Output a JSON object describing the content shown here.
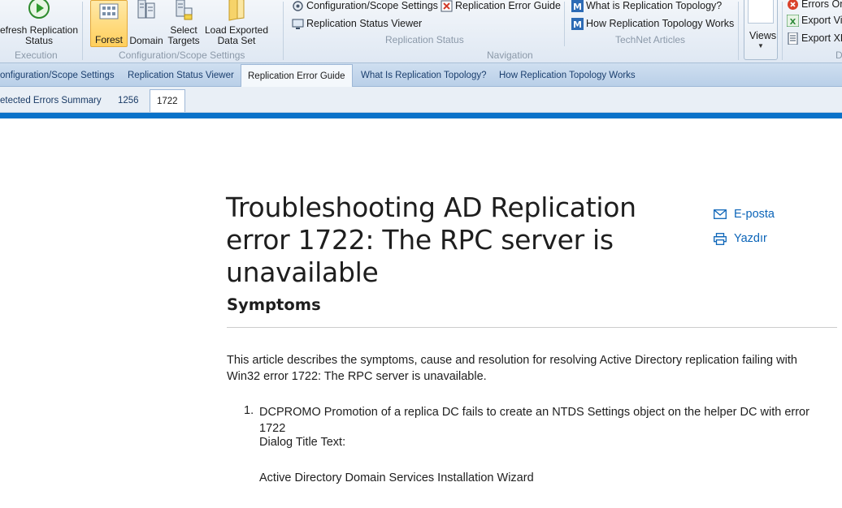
{
  "ribbon": {
    "execution": {
      "label": "Execution",
      "refresh": "efresh Replication\nStatus"
    },
    "config": {
      "label": "Configuration/Scope Settings",
      "forest": "Forest",
      "domain": "Domain",
      "select_targets": "Select\nTargets",
      "load_exported": "Load Exported\nData Set"
    },
    "replication_status": {
      "label": "Replication Status",
      "config_scope": "Configuration/Scope Settings",
      "error_guide": "Replication Error Guide",
      "status_viewer": "Replication Status Viewer"
    },
    "navigation": {
      "label": "Navigation"
    },
    "technet": {
      "label": "TechNet Articles",
      "what_is": "What is Replication Topology?",
      "how": "How Replication Topology Works"
    },
    "views": {
      "label": "Views"
    },
    "export": {
      "label": "D",
      "errors_only": "Errors On",
      "export_view": "Export Vie",
      "export_xps": "Export XP"
    }
  },
  "tabs_primary": [
    {
      "label": "onfiguration/Scope Settings"
    },
    {
      "label": "Replication Status Viewer"
    },
    {
      "label": "Replication Error Guide"
    },
    {
      "label": "What Is Replication Topology?"
    },
    {
      "label": "How Replication Topology Works"
    }
  ],
  "tabs_secondary": [
    {
      "label": "etected Errors Summary"
    },
    {
      "label": "1256"
    },
    {
      "label": "1722"
    }
  ],
  "article": {
    "title": "Troubleshooting AD Replication error 1722: The RPC server is unavailable",
    "email": "E-posta",
    "print": "Yazdır",
    "section": "Symptoms",
    "intro": " This article describes the symptoms, cause and resolution for resolving Active Directory replication failing with Win32 error 1722: The RPC server is unavailable.",
    "item1_number": "1.",
    "item1_text": "DCPROMO Promotion of a replica DC fails to create an NTDS Settings object on the helper DC with error 1722",
    "dialog_title": "Dialog Title Text:",
    "wizard": "Active Directory Domain Services Installation Wizard"
  },
  "colors": {
    "accent_blue": "#0a72c9",
    "link": "#0b64b8",
    "tab_text": "#1b3f6e",
    "active_button": "#ffcf5c"
  }
}
